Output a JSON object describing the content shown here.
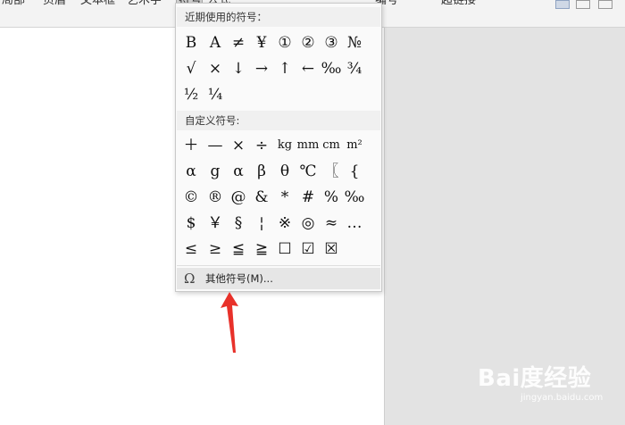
{
  "toolbar": {
    "items": [
      "局部",
      "页眉",
      "文本框",
      "艺术字",
      "符号",
      "公式",
      "编号",
      "超链接"
    ]
  },
  "menu": {
    "recent_header": "近期使用的符号：",
    "recent": [
      "B",
      "A",
      "≠",
      "¥",
      "①",
      "②",
      "③",
      "№",
      "√",
      "×",
      "↓",
      "→",
      "↑",
      "←",
      "‰",
      "¾",
      "½",
      "¼"
    ],
    "custom_header": "自定义符号:",
    "custom": [
      "＋",
      "—",
      "×",
      "÷",
      "kg",
      "mm",
      "cm",
      "m²",
      "α",
      "g",
      "α",
      "β",
      "θ",
      "℃",
      "〖",
      "{",
      "©",
      "®",
      "@",
      "&",
      "*",
      "#",
      "%",
      "‰",
      "$",
      "￥",
      "§",
      "¦",
      "※",
      "◎",
      "≈",
      "…",
      "≤",
      "≥",
      "≦",
      "≧",
      "☐",
      "☑",
      "☒"
    ],
    "more_label": "其他符号(M)...",
    "more_icon": "omega-icon"
  },
  "watermark": {
    "text": "Bai度经验",
    "sub": "jingyan.baidu.com"
  }
}
